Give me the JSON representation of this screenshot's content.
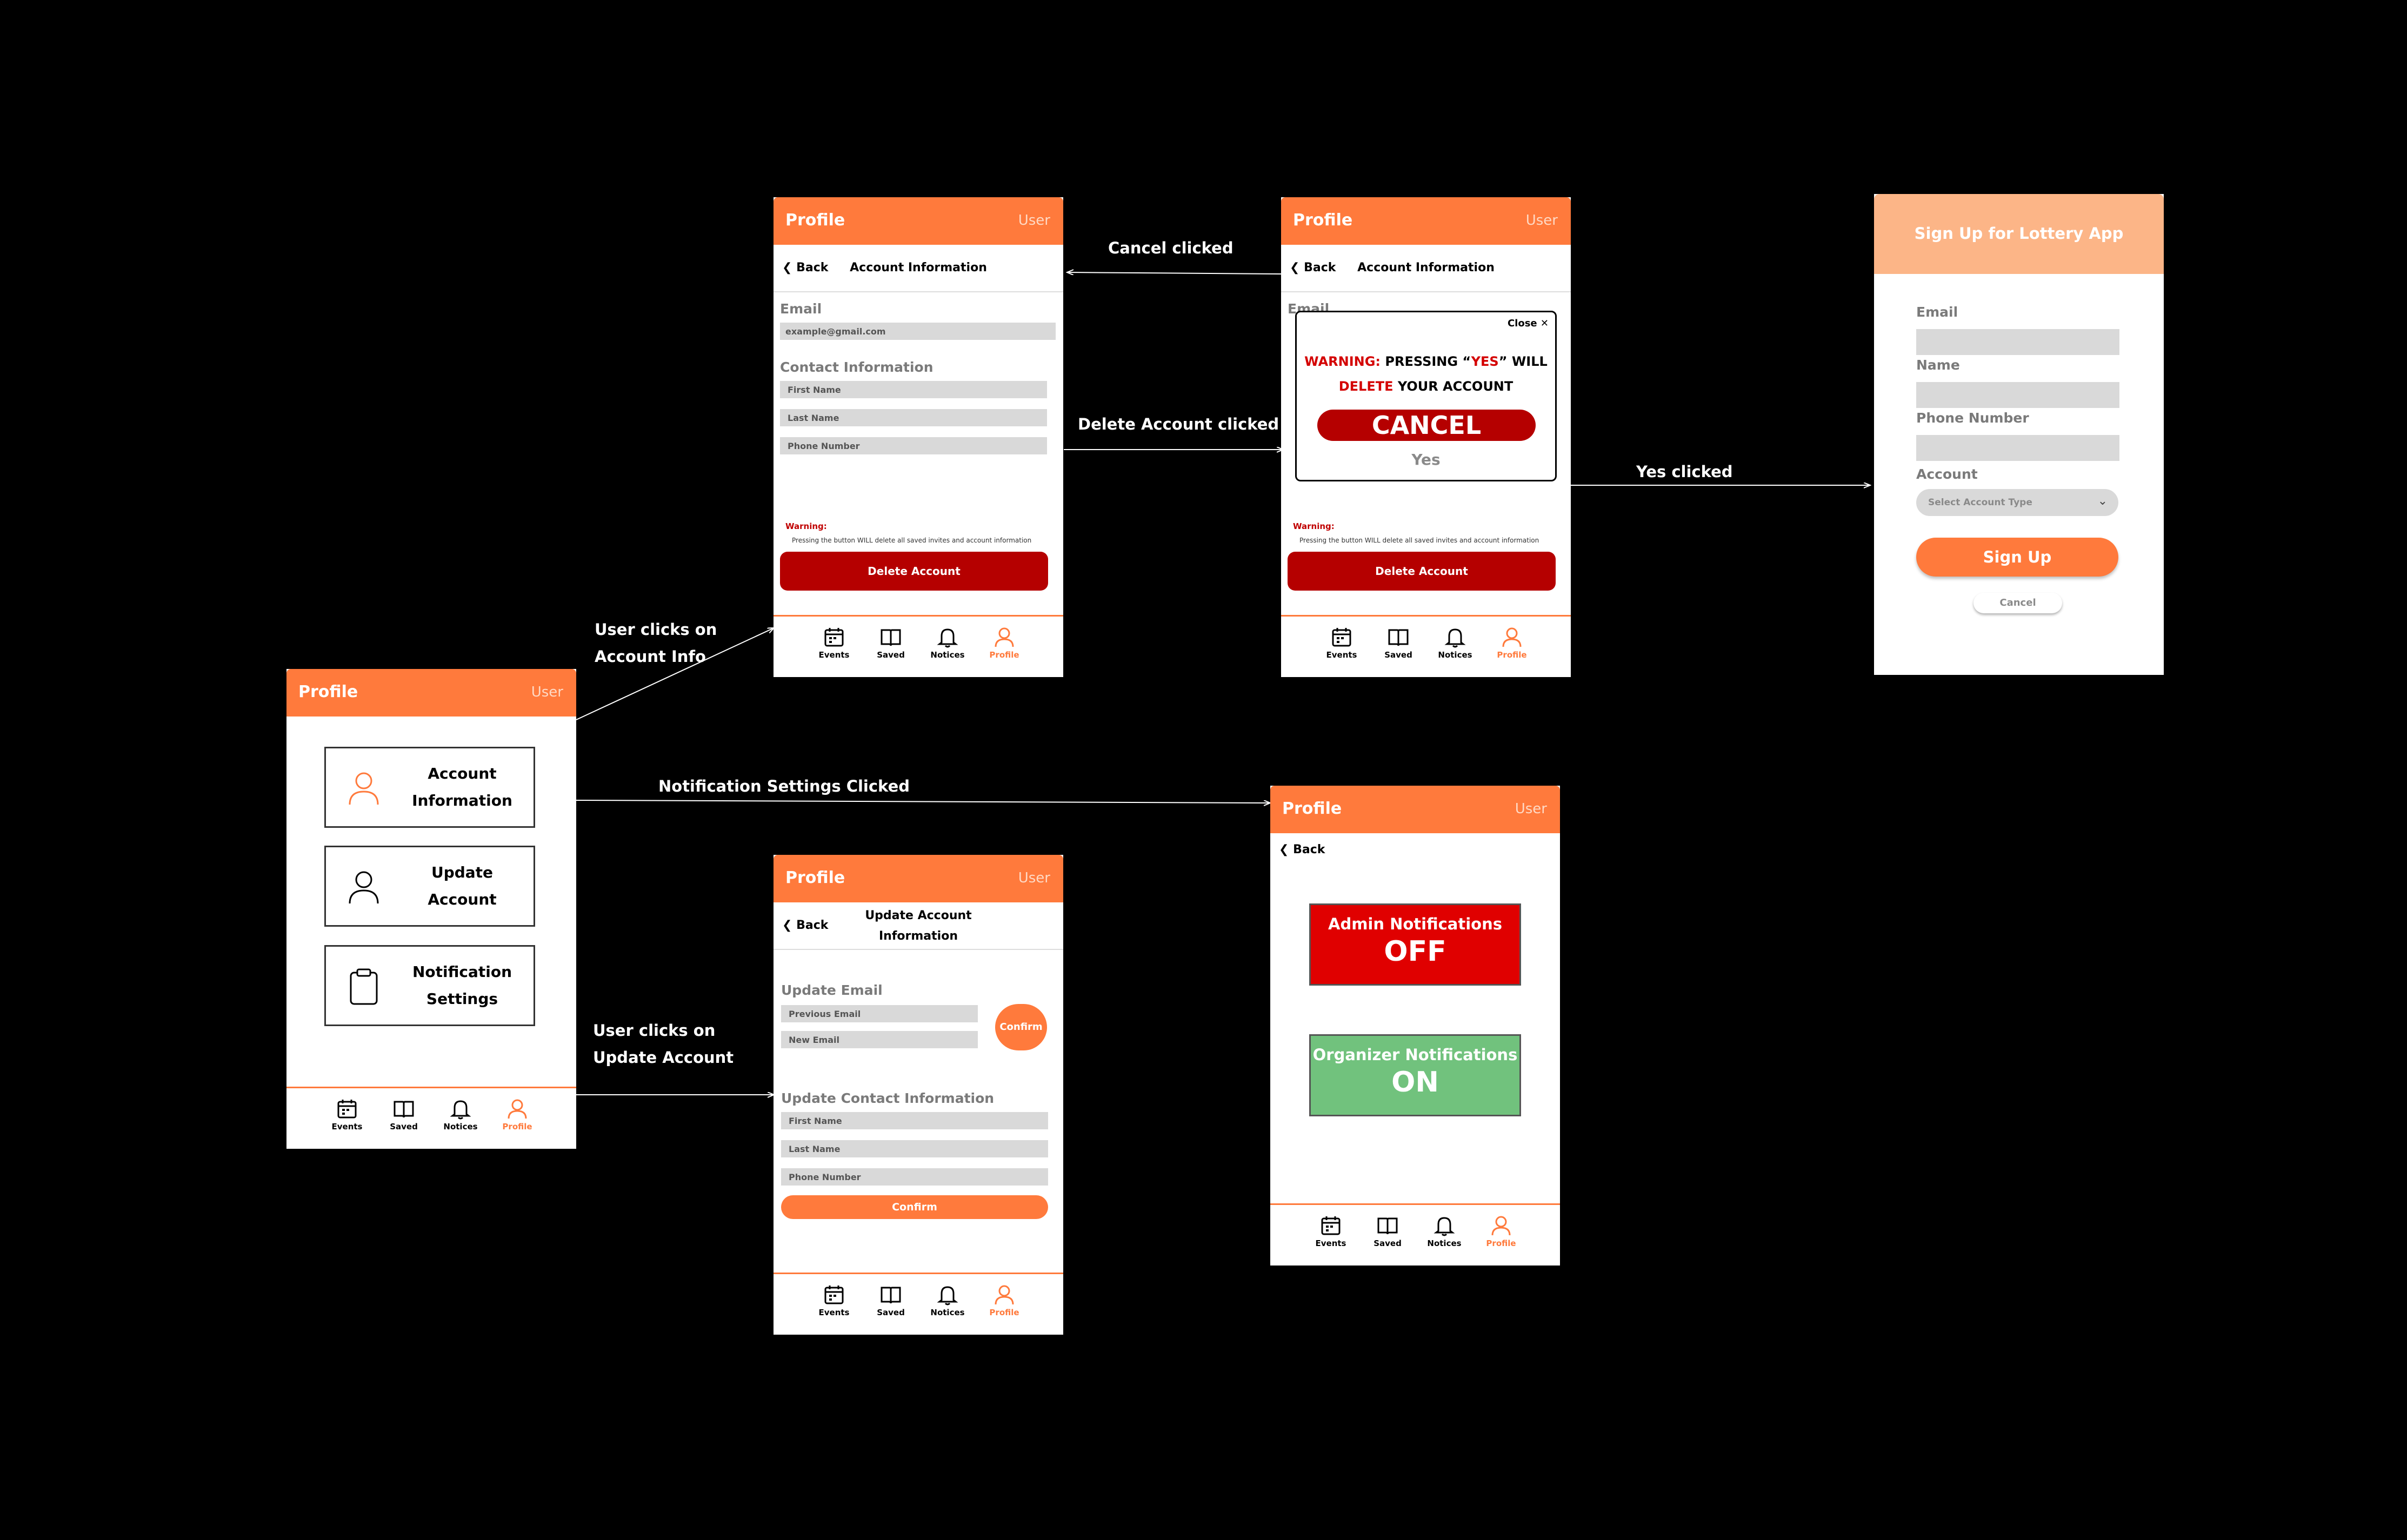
{
  "common": {
    "header_title": "Profile",
    "header_user": "User",
    "back_label": "Back",
    "nav": [
      "Events",
      "Saved",
      "Notices",
      "Profile"
    ]
  },
  "annotations": {
    "account_info_line1": "User clicks on",
    "account_info_line2": "Account Info",
    "notification_settings": "Notification Settings Clicked",
    "update_account_line1": "User clicks on",
    "update_account_line2": "Update Account",
    "cancel_clicked": "Cancel clicked",
    "delete_clicked": "Delete Account clicked",
    "yes_clicked": "Yes clicked"
  },
  "profile_menu": {
    "account_info_line1": "Account",
    "account_info_line2": "Information",
    "update_account": "Update Account",
    "notification_line1": "Notification",
    "notification_line2": "Settings"
  },
  "account_info": {
    "title": "Account Information",
    "email_label": "Email",
    "email_value": "example@gmail.com",
    "contact_label": "Contact Information",
    "first_name": "First Name",
    "last_name": "Last Name",
    "phone": "Phone Number",
    "warning_title": "Warning:",
    "warning_text": "Pressing the button WILL delete all saved invites and account information",
    "delete_button": "Delete Account"
  },
  "dialog": {
    "close_label": "Close",
    "warning_word": "WARNING:",
    "pressing": "PRESSING “",
    "yes_word": "YES",
    "will": "” WILL",
    "delete_word": "DELETE",
    "your_account": "YOUR ACCOUNT",
    "cancel_button": "CANCEL",
    "yes_button": "Yes",
    "behind_email_label": "Email"
  },
  "signup": {
    "title": "Sign Up for Lottery App",
    "email_label": "Email",
    "name_label": "Name",
    "phone_label": "Phone Number",
    "account_label": "Account",
    "account_placeholder": "Select Account Type",
    "signup_button": "Sign Up",
    "cancel_button": "Cancel"
  },
  "update_account": {
    "title_line1": "Update Account",
    "title_line2": "Information",
    "email_label": "Update Email",
    "previous_email": "Previous Email",
    "new_email": "New Email",
    "confirm_small": "Confirm",
    "contact_label": "Update Contact Information",
    "first_name": "First Name",
    "last_name": "Last Name",
    "phone": "Phone Number",
    "confirm_button": "Confirm"
  },
  "notifications": {
    "admin_label": "Admin Notifications",
    "admin_state": "OFF",
    "admin_color": "#e00000",
    "organizer_label": "Organizer Notifications",
    "organizer_state": "ON",
    "organizer_color": "#71c27d"
  }
}
